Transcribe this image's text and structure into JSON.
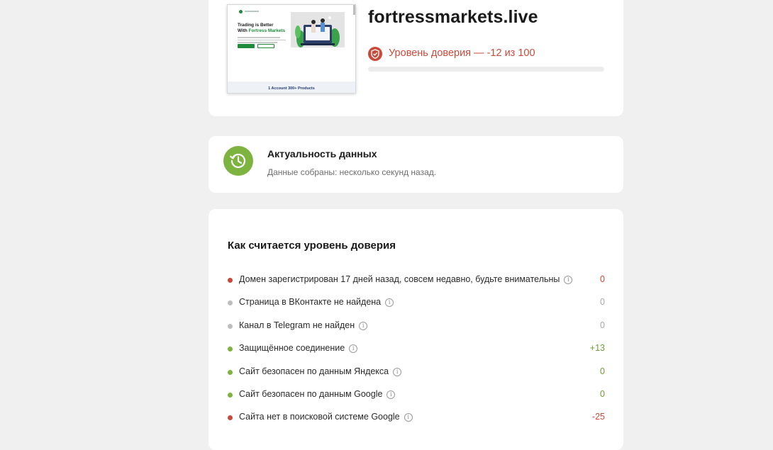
{
  "site": {
    "domain": "fortressmarkets.live",
    "trust_label": "Уровень доверия — -12 из 100",
    "trust_score": -12,
    "trust_max": 100,
    "accent_bad": "#c94a3a",
    "accent_good": "#7db33f"
  },
  "thumbnail": {
    "hero_line1": "Trading is Better",
    "hero_line2_prefix": "With ",
    "hero_line2_brand": "Fortress Markets",
    "footer_text": "1 Account 300+ Products"
  },
  "freshness": {
    "title": "Актуальность данных",
    "subtitle": "Данные собраны: несколько секунд назад.",
    "icon": "clock-history-icon"
  },
  "calc": {
    "title": "Как считается уровень доверия",
    "factors": [
      {
        "label": "Домен зарегистрирован 17 дней назад, совсем недавно, будьте внимательны",
        "score": "0",
        "status": "bad"
      },
      {
        "label": "Страница в ВКонтакте не найдена",
        "score": "0",
        "status": "neutral"
      },
      {
        "label": "Канал в Telegram не найден",
        "score": "0",
        "status": "neutral"
      },
      {
        "label": "Защищённое соединение",
        "score": "+13",
        "status": "good"
      },
      {
        "label": "Сайт безопасен по данным Яндекса",
        "score": "0",
        "status": "good"
      },
      {
        "label": "Сайт безопасен по данным Google",
        "score": "0",
        "status": "good"
      },
      {
        "label": "Сайта нет в поисковой системе Google",
        "score": "-25",
        "status": "bad"
      }
    ]
  }
}
